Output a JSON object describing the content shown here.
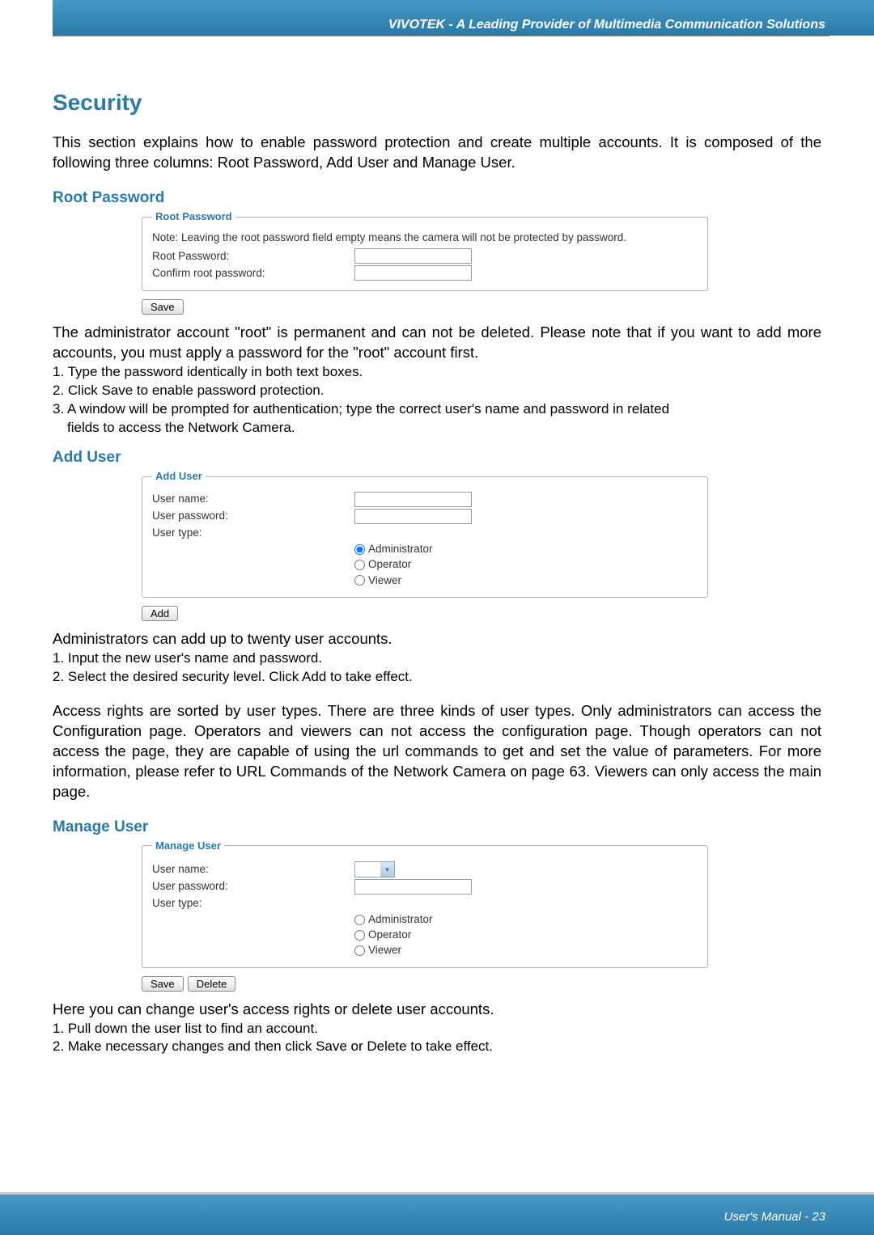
{
  "header": {
    "title": "VIVOTEK - A Leading Provider of Multimedia Communication Solutions"
  },
  "page": {
    "title": "Security",
    "intro": "This section explains how to enable password protection and create multiple accounts. It is composed of the following three columns: Root Password, Add User and Manage User."
  },
  "root_password": {
    "section_label": "Root Password",
    "legend": "Root Password",
    "note": "Note: Leaving the root password field empty means the camera will not be protected by password.",
    "label_root": "Root Password:",
    "label_confirm": "Confirm root password:",
    "save_btn": "Save",
    "para1": "The administrator account \"root\" is permanent and can not be deleted. Please note that if you want to add more accounts, you must apply a password for the \"root\" account first.",
    "step1": "1. Type the password identically in both text boxes.",
    "step2": "2. Click Save to enable password protection.",
    "step3": "3. A window will be prompted for authentication; type the correct user's name and password in related",
    "step3b": "fields to access the Network Camera."
  },
  "add_user": {
    "section_label": "Add User",
    "legend": "Add User",
    "label_name": "User name:",
    "label_pass": "User password:",
    "label_type": "User type:",
    "opt_admin": "Administrator",
    "opt_operator": "Operator",
    "opt_viewer": "Viewer",
    "add_btn": "Add",
    "para1": "Administrators can add up to twenty user accounts.",
    "step1": "1. Input the new user's name and password.",
    "step2": "2. Select the desired security level. Click Add to take effect.",
    "access_para": "Access rights are sorted by user types. There are three kinds of user types. Only administrators can access the Configuration page. Operators and viewers can not access the configuration page. Though operators can not access the page, they are capable of using the url commands to get and set the value of parameters. For more information, please refer to URL Commands of the Network Camera on page 63. Viewers can only access the main page."
  },
  "manage_user": {
    "section_label": "Manage User",
    "legend": "Manage User",
    "label_name": "User name:",
    "label_pass": "User password:",
    "label_type": "User type:",
    "opt_admin": "Administrator",
    "opt_operator": "Operator",
    "opt_viewer": "Viewer",
    "save_btn": "Save",
    "delete_btn": "Delete",
    "para1": "Here you can change user's access rights or delete user accounts.",
    "step1": "1. Pull down the user list to find an account.",
    "step2": "2. Make necessary changes and then click Save or Delete to take effect."
  },
  "footer": {
    "text": "User's Manual - 23"
  }
}
